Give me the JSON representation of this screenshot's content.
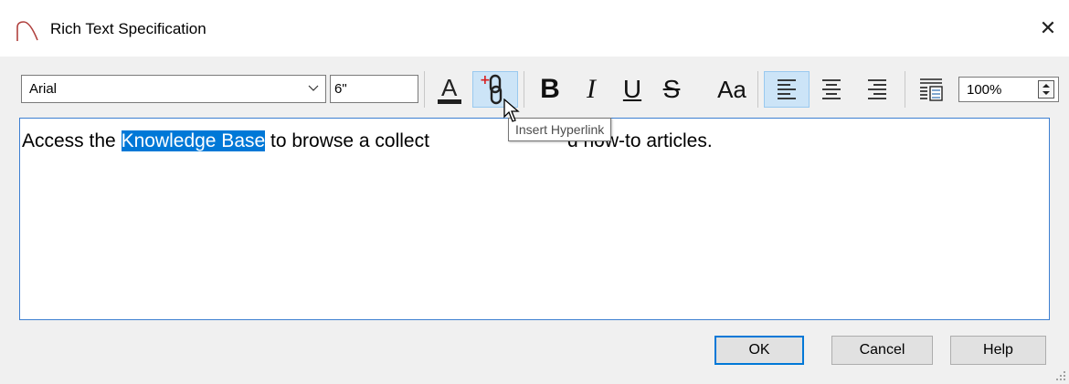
{
  "window": {
    "title": "Rich Text Specification",
    "close_glyph": "✕"
  },
  "toolbar": {
    "font_family": "Arial",
    "font_size": "6\"",
    "text_color_label": "A",
    "text_color_swatch": "#1f1f1f",
    "bold_label": "B",
    "italic_label": "I",
    "underline_label": "U",
    "strike_label": "S",
    "case_label": "Aa",
    "zoom_value": "100%",
    "icons": [
      "font-dropdown-chevron-icon",
      "text-color-icon",
      "insert-hyperlink-icon",
      "bold-icon",
      "italic-icon",
      "underline-icon",
      "strikethrough-icon",
      "change-case-icon",
      "align-left-icon",
      "align-center-icon",
      "align-right-icon",
      "columns-icon",
      "spinner-icon"
    ]
  },
  "editor": {
    "text_before": "Access the ",
    "text_selected": "Knowledge Base",
    "text_after": " to browse a collect",
    "text_end": "d how-to articles."
  },
  "tooltip": {
    "text": "Insert Hyperlink"
  },
  "buttons": {
    "ok": "OK",
    "cancel": "Cancel",
    "help": "Help"
  },
  "colors": {
    "selection": "#0078d7",
    "accent_border": "#3c7fd1",
    "app_icon": "#b0413e"
  }
}
